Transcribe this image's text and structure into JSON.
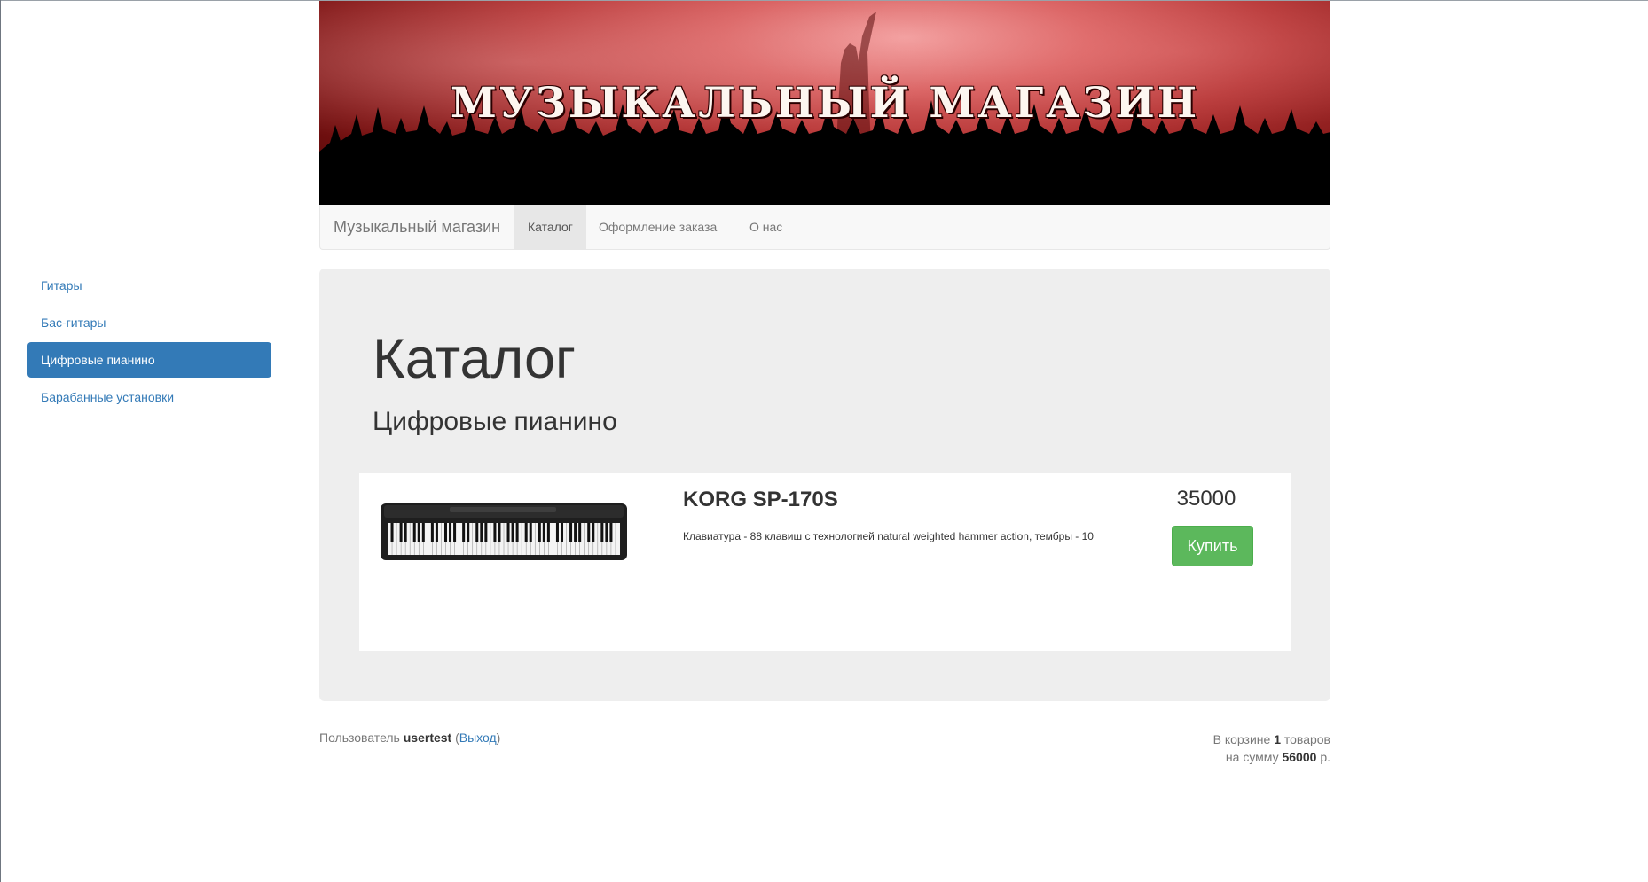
{
  "banner": {
    "title": "МУЗЫКАЛЬНЫЙ МАГАЗИН"
  },
  "navbar": {
    "brand": "Музыкальный магазин",
    "items": [
      {
        "label": "Каталог",
        "active": true
      },
      {
        "label": "Оформление заказа",
        "active": false
      },
      {
        "label": "О нас",
        "active": false
      }
    ]
  },
  "sidebar": {
    "items": [
      {
        "label": "Гитары",
        "active": false
      },
      {
        "label": "Бас-гитары",
        "active": false
      },
      {
        "label": "Цифровые пианино",
        "active": true
      },
      {
        "label": "Барабанные установки",
        "active": false
      }
    ]
  },
  "main": {
    "heading": "Каталог",
    "subheading": "Цифровые пианино",
    "products": [
      {
        "name": "KORG SP-170S",
        "description": "Клавиатура - 88 клавиш с технологией natural weighted hammer action, тембры - 10",
        "price": "35000",
        "buy_label": "Купить",
        "image_icon": "digital-piano"
      }
    ]
  },
  "footer": {
    "user_prefix": "Пользователь",
    "username": "usertest",
    "logout_label": "Выход",
    "cart_line1_prefix": "В корзине",
    "cart_count": "1",
    "cart_line1_suffix": "товаров",
    "cart_line2_prefix": "на сумму",
    "cart_total": "56000",
    "cart_line2_suffix": "р."
  },
  "colors": {
    "accent": "#337ab7",
    "buy_button": "#5cb85c",
    "jumbotron": "#eeeeee"
  }
}
